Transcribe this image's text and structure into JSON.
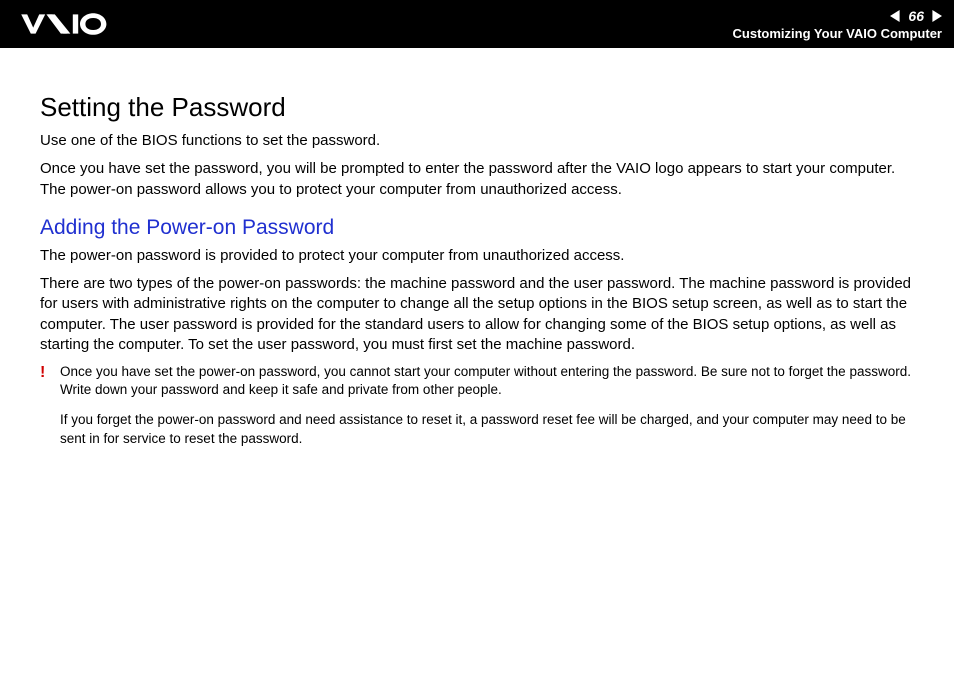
{
  "header": {
    "page_number": "66",
    "section_title": "Customizing Your VAIO Computer"
  },
  "main": {
    "title": "Setting the Password",
    "intro_1": "Use one of the BIOS functions to set the password.",
    "intro_2": "Once you have set the password, you will be prompted to enter the password after the VAIO logo appears to start your computer. The power-on password allows you to protect your computer from unauthorized access.",
    "subheading": "Adding the Power-on Password",
    "para_1": "The power-on password is provided to protect your computer from unauthorized access.",
    "para_2": "There are two types of the power-on passwords: the machine password and the user password. The machine password is provided for users with administrative rights on the computer to change all the setup options in the BIOS setup screen, as well as to start the computer. The user password is provided for the standard users to allow for changing some of the BIOS setup options, as well as starting the computer. To set the user password, you must first set the machine password.",
    "note_mark": "!",
    "note_1": "Once you have set the power-on password, you cannot start your computer without entering the password. Be sure not to forget the password. Write down your password and keep it safe and private from other people.",
    "note_2": "If you forget the power-on password and need assistance to reset it, a password reset fee will be charged, and your computer may need to be sent in for service to reset the password."
  }
}
